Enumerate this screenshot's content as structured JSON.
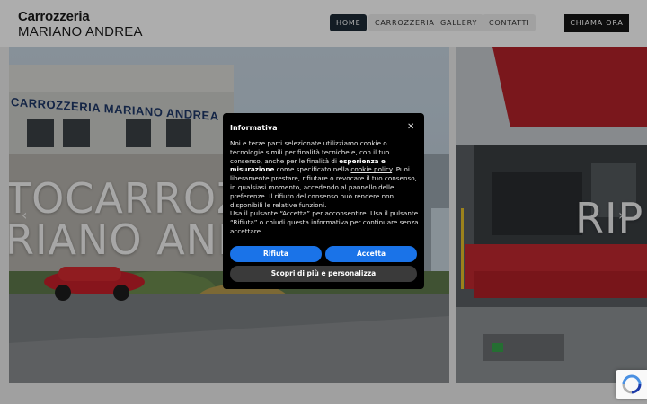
{
  "header": {
    "logo_line1": "Carrozzeria",
    "logo_line2": "MARIANO ANDREA",
    "nav": [
      "HOME",
      "CARROZZERIA",
      "GALLERY",
      "CONTATTI"
    ],
    "cta": "CHIAMA ORA"
  },
  "slider": {
    "left_line1": "TOCARROZZ",
    "left_line2": "RIANO ANI",
    "right_text": "RIP",
    "building_sign": "CARROZZERIA MARIANO ANDREA",
    "prev_icon": "chevron-left-icon",
    "next_icon": "chevron-right-icon"
  },
  "cookie_dialog": {
    "title": "Informativa",
    "close_icon": "close-icon",
    "text_1": "Noi e terze parti selezionate utilizziamo cookie o tecnologie simili per finalità tecniche e, con il tuo consenso, anche per le finalità di ",
    "text_bold": "esperienza e misurazione",
    "text_2": " come specificato nella ",
    "text_link": "cookie policy",
    "text_3": ". Puoi liberamente prestare, rifiutare o revocare il tuo consenso, in qualsiasi momento, accedendo al pannello delle preferenze. Il rifiuto del consenso può rendere non disponibili le relative funzioni.",
    "text_4": "Usa il pulsante “Accetta” per acconsentire. Usa il pulsante “Rifiuta” o chiudi questa informativa per continuare senza accettare.",
    "reject_label": "Rifiuta",
    "accept_label": "Accetta",
    "more_label": "Scopri di più e personalizza"
  },
  "colors": {
    "accent": "#1a73e8",
    "dialog_bg": "#000000",
    "nav_active": "#1c2a36"
  }
}
